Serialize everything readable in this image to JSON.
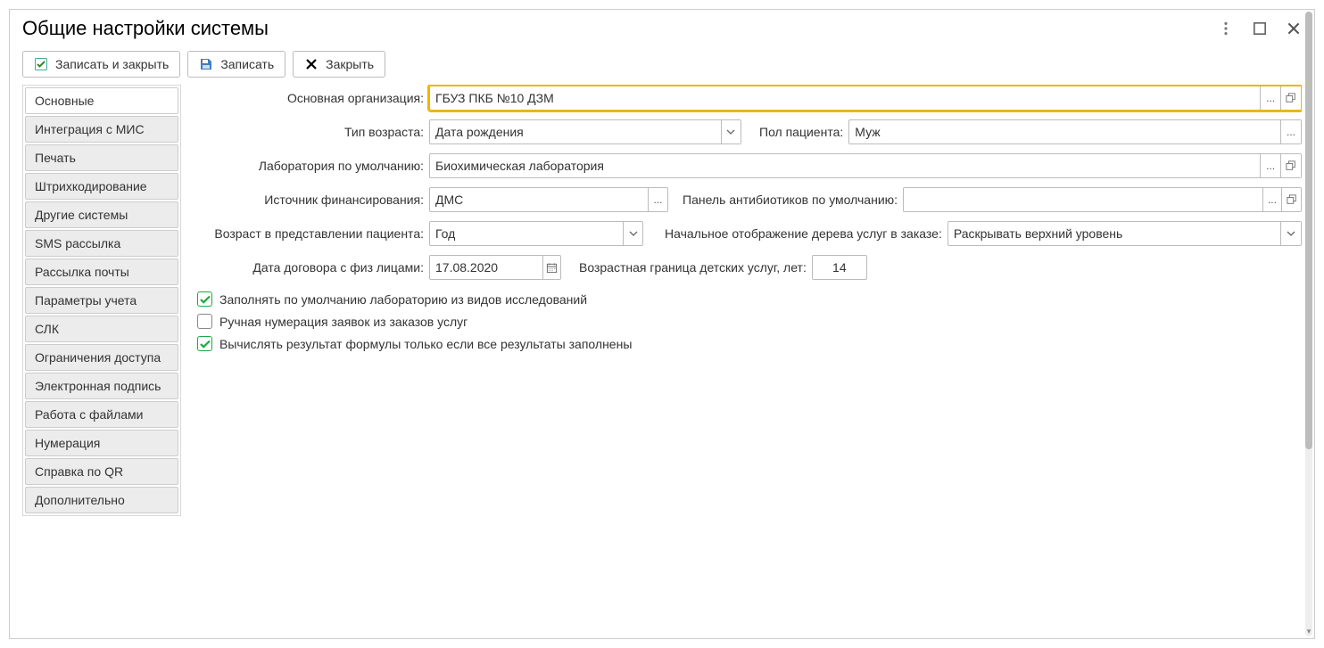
{
  "title": "Общие настройки системы",
  "toolbar": {
    "save_close": "Записать и закрыть",
    "save": "Записать",
    "close": "Закрыть"
  },
  "tabs": [
    "Основные",
    "Интеграция с МИС",
    "Печать",
    "Штрихкодирование",
    "Другие системы",
    "SMS рассылка",
    "Рассылка почты",
    "Параметры учета",
    "СЛК",
    "Ограничения доступа",
    "Электронная подпись",
    "Работа с файлами",
    "Нумерация",
    "Справка по QR",
    "Дополнительно"
  ],
  "labels": {
    "org": "Основная организация:",
    "age_type": "Тип возраста:",
    "sex": "Пол пациента:",
    "lab": "Лаборатория по умолчанию:",
    "fin": "Источник финансирования:",
    "ab_panel": "Панель антибиотиков по умолчанию:",
    "age_repr": "Возраст в представлении пациента:",
    "tree": "Начальное отображение дерева услуг в заказе:",
    "contract_date": "Дата договора с физ лицами:",
    "child_age": "Возрастная граница детских услуг, лет:"
  },
  "values": {
    "org": "ГБУЗ ПКБ №10 ДЗМ",
    "age_type": "Дата рождения",
    "sex": "Муж",
    "lab": "Биохимическая лаборатория",
    "fin": "ДМС",
    "ab_panel": "",
    "age_repr": "Год",
    "tree": "Раскрывать верхний уровень",
    "contract_date": "17.08.2020",
    "child_age": "14"
  },
  "checks": {
    "fill_lab": "Заполнять по умолчанию лабораторию из видов исследований",
    "manual_num": "Ручная нумерация заявок из заказов услуг",
    "calc_formula": "Вычислять результат формулы только если все результаты заполнены"
  },
  "symbols": {
    "dots": "..."
  }
}
